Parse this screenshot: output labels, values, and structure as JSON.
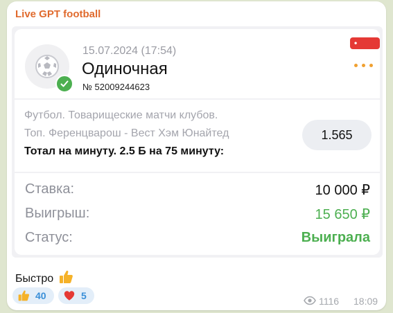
{
  "post": {
    "channel_name": "Live GPT football",
    "caption": "Быстро",
    "caption_emoji": "thumbs-up-icon",
    "reactions": [
      {
        "emoji": "thumbs-up-icon",
        "count": "40"
      },
      {
        "emoji": "heart-icon",
        "count": "5"
      }
    ],
    "views": "1116",
    "time": "18:09"
  },
  "bet": {
    "date": "15.07.2024 (17:54)",
    "type": "Одиночная",
    "number": "№ 52009244623",
    "live_label": "• Live",
    "event_line1": "Футбол. Товарищеские матчи клубов.",
    "event_line2": "Топ. Ференцварош - Вест Хэм Юнайтед",
    "market": "Тотал на минуту. 2.5 Б на 75 минуту:",
    "odds": "1.565",
    "stake_label": "Ставка:",
    "stake_value": "10 000 ₽",
    "win_label": "Выигрыш:",
    "win_value": "15 650 ₽",
    "status_label": "Статус:",
    "status_value": "Выиграла"
  },
  "colors": {
    "channel": "#e06a2d",
    "win": "#4caf50",
    "live": "#e53935",
    "accent": "#3a8fd8"
  }
}
